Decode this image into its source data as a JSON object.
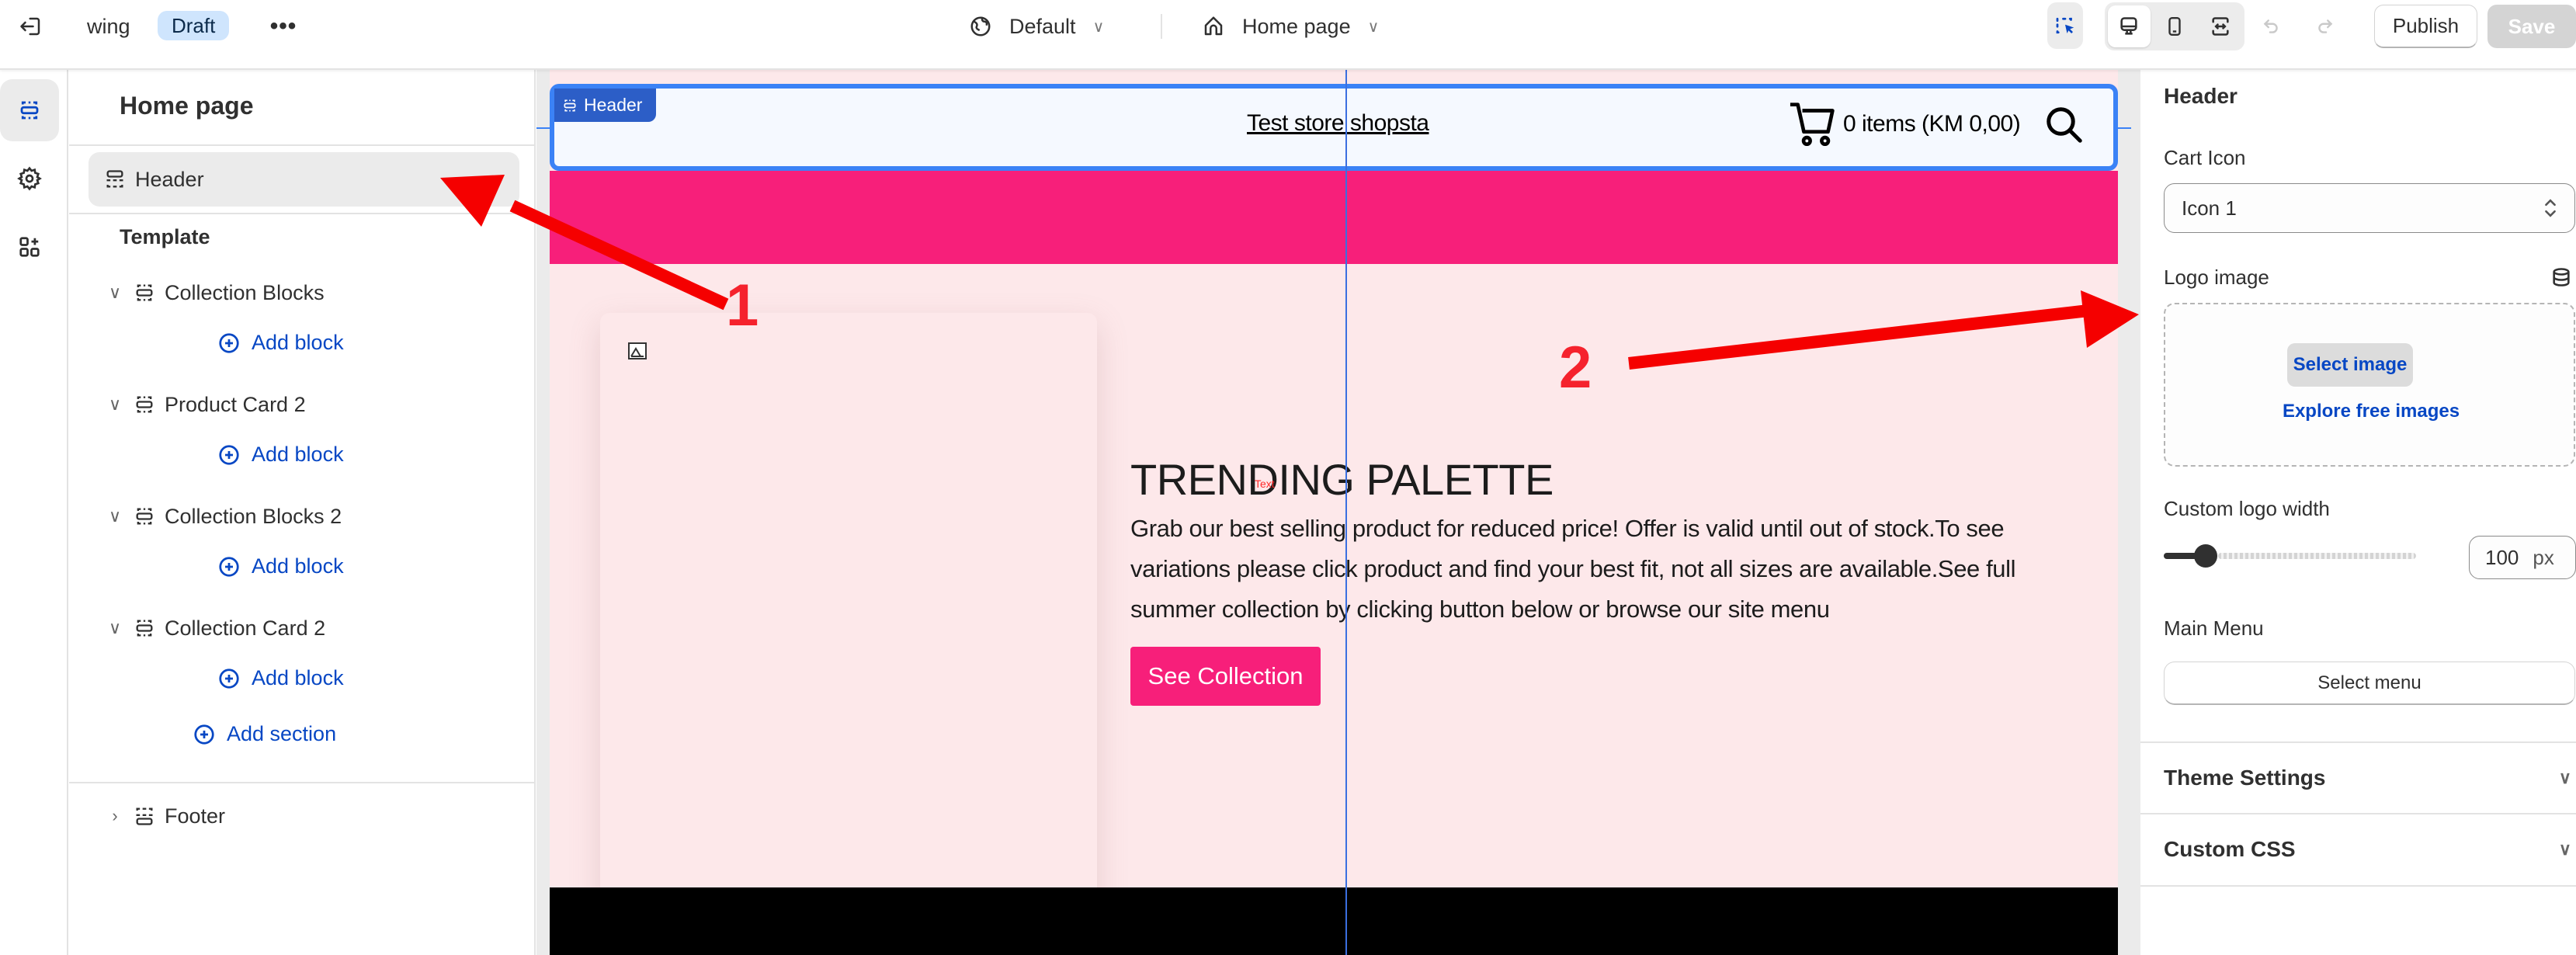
{
  "topbar": {
    "store_name": "wing",
    "status_badge": "Draft",
    "more_label": "•••",
    "theme_selector": "Default",
    "page_selector": "Home page",
    "publish_label": "Publish",
    "save_label": "Save",
    "icons": {
      "exit": "exit-icon",
      "theme": "globe-icon",
      "page": "home-icon",
      "inspector": "select-cursor-icon",
      "desktop": "desktop-icon",
      "mobile": "mobile-icon",
      "fullwidth": "expand-horizontal-icon",
      "undo": "undo-icon",
      "redo": "redo-icon"
    }
  },
  "rail": {
    "items": [
      {
        "icon": "sections-icon",
        "active": true
      },
      {
        "icon": "gear-icon",
        "active": false
      },
      {
        "icon": "apps-icon",
        "active": false
      }
    ]
  },
  "left_panel": {
    "title": "Home page",
    "header_item": "Header",
    "template_label": "Template",
    "sections": [
      {
        "label": "Collection Blocks",
        "expanded": true,
        "add_block": "Add block"
      },
      {
        "label": "Product Card 2",
        "expanded": true,
        "add_block": "Add block"
      },
      {
        "label": "Collection Blocks 2",
        "expanded": true,
        "add_block": "Add block"
      },
      {
        "label": "Collection Card 2",
        "expanded": true,
        "add_block": "Add block"
      }
    ],
    "add_section": "Add section",
    "footer_item": "Footer"
  },
  "preview": {
    "header_tag": "Header",
    "store_title": "Test store shopsta",
    "cart_text": "0 items (KM 0,00)",
    "hero_title": "TRENDING PALETTE",
    "text_marker": "Text",
    "hero_body": "Grab our best selling product for reduced price! Offer is valid until out of stock.To see variations please click product and find your best fit, not all sizes are available.See full summer collection by clicking button below or browse our site menu",
    "cta_label": "See Collection",
    "colors": {
      "brand_pink": "#f71f7a",
      "hero_bg": "#fde8ea",
      "selection_blue": "#3b82f6",
      "footer_bg": "#000000"
    }
  },
  "right_panel": {
    "title": "Header",
    "cart_icon_label": "Cart Icon",
    "cart_icon_value": "Icon 1",
    "logo_image_label": "Logo image",
    "select_image": "Select image",
    "explore_images": "Explore free images",
    "logo_width_label": "Custom logo width",
    "logo_width_value": "100",
    "logo_width_unit": "px",
    "logo_width_slider_fraction": 0.12,
    "main_menu_label": "Main Menu",
    "select_menu": "Select menu",
    "accordions": [
      "Theme Settings",
      "Custom CSS"
    ]
  },
  "annotations": {
    "labels": [
      "1",
      "2"
    ],
    "color": "#f50000"
  }
}
